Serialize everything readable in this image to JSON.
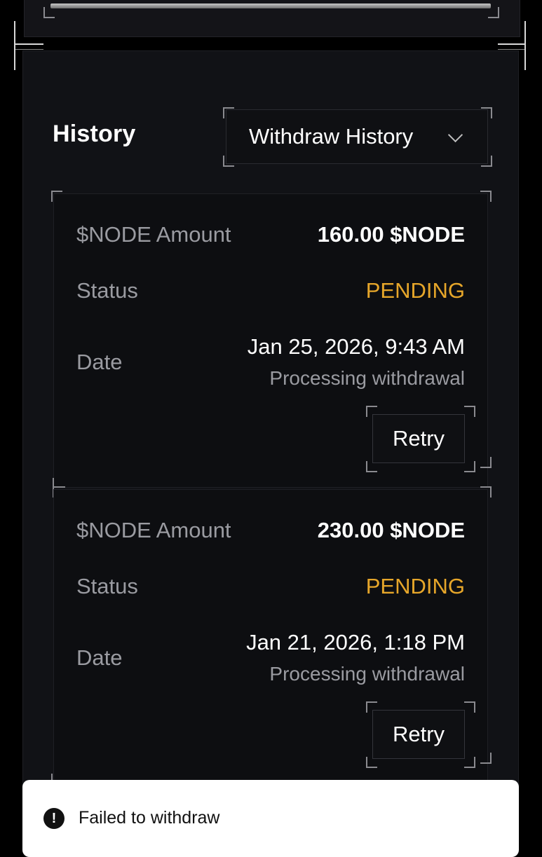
{
  "history": {
    "title": "History",
    "dropdown": {
      "selected": "Withdraw History",
      "icon": "chevron-down-icon"
    }
  },
  "entries": [
    {
      "amount_label": "$NODE Amount",
      "amount": "160.00 $NODE",
      "status_label": "Status",
      "status": "PENDING",
      "date_label": "Date",
      "date": "Jan 25, 2026, 9:43 AM",
      "note": "Processing withdrawal",
      "retry_label": "Retry"
    },
    {
      "amount_label": "$NODE Amount",
      "amount": "230.00 $NODE",
      "status_label": "Status",
      "status": "PENDING",
      "date_label": "Date",
      "date": "Jan 21, 2026, 1:18 PM",
      "note": "Processing withdrawal",
      "retry_label": "Retry"
    }
  ],
  "toast": {
    "message": "Failed to withdraw",
    "icon": "alert-circle-icon"
  },
  "colors": {
    "pending": "#e6a62a",
    "background": "#111216",
    "card": "#0d0e11"
  }
}
